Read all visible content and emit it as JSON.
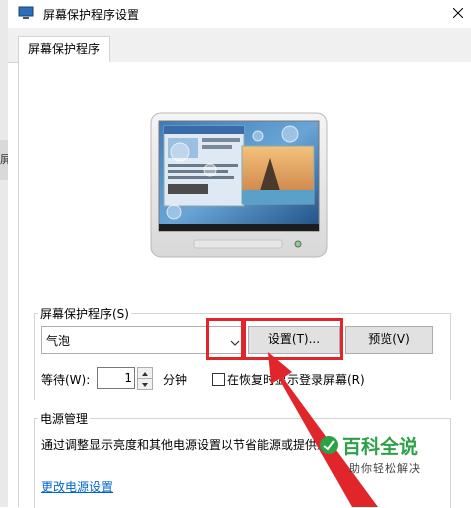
{
  "window": {
    "title": "屏幕保护程序设置"
  },
  "tabs": [
    {
      "label": "屏幕保护程序"
    }
  ],
  "screensaver": {
    "group_label": "屏幕保护程序(S)",
    "selected": "气泡",
    "settings_label": "设置(T)...",
    "preview_label": "预览(V)",
    "wait_label": "等待(W):",
    "wait_value": "1",
    "minutes_label": "分钟",
    "resume_label": "在恢复时显示登录屏幕(R)"
  },
  "power": {
    "group_label": "电源管理",
    "description": "通过调整显示亮度和其他电源设置以节省能源或提供最",
    "link_label": "更改电源设置"
  },
  "watermark": {
    "title": "百科全说",
    "subtitle": "助你轻松解决"
  },
  "side_mark": "屏",
  "colors": {
    "annotation_red": "#e0262a",
    "link": "#0066cc",
    "brand_green": "#2ba245"
  }
}
